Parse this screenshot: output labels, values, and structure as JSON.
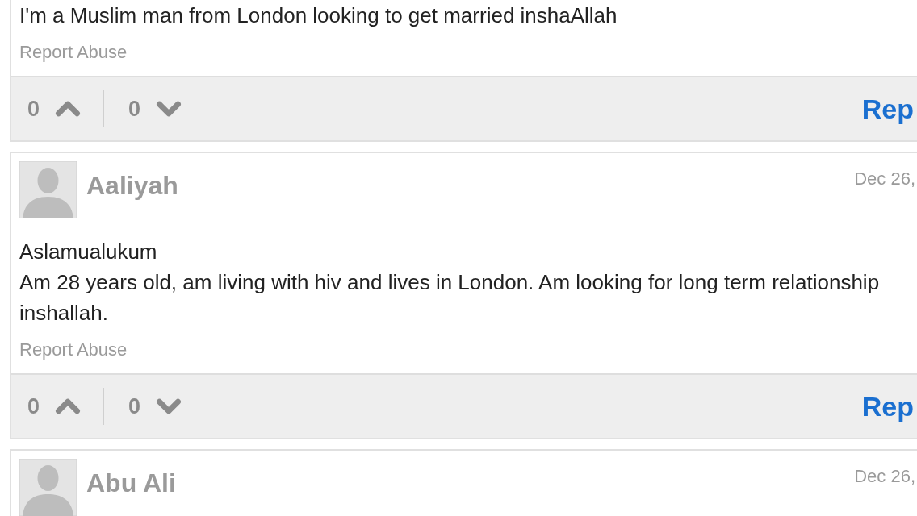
{
  "comments": [
    {
      "body": [
        "I'm a Muslim man from London looking to get married inshaAllah"
      ],
      "report": "Report Abuse",
      "upvotes": "0",
      "downvotes": "0",
      "reply": "Rep"
    },
    {
      "author": "Aaliyah",
      "date": "Dec 26,",
      "body": [
        "Aslamualukum",
        "Am 28 years old, am living with hiv and lives in London. Am looking for long term relationship inshallah."
      ],
      "report": "Report Abuse",
      "upvotes": "0",
      "downvotes": "0",
      "reply": "Rep"
    },
    {
      "author": "Abu Ali",
      "date": "Dec 26,"
    }
  ]
}
